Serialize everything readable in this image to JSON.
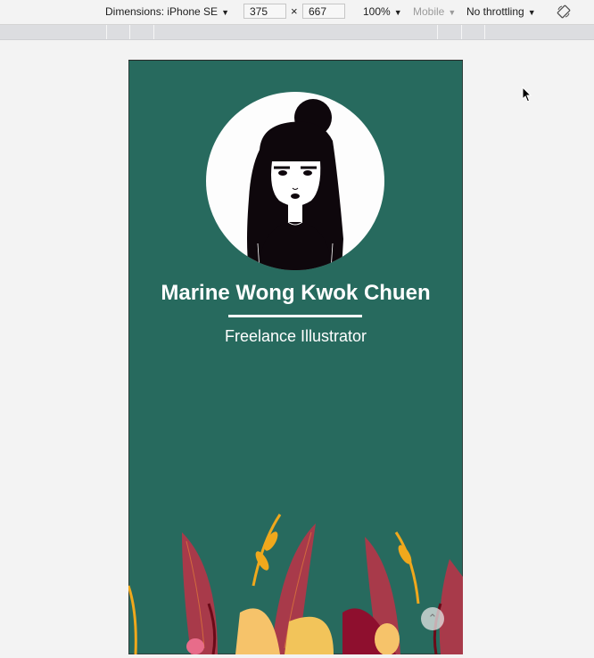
{
  "devtools": {
    "dimensions_label": "Dimensions: iPhone SE",
    "width_value": "375",
    "times_symbol": "×",
    "height_value": "667",
    "zoom": "100%",
    "device_type": "Mobile",
    "throttling": "No throttling",
    "icons": [
      "dropdown-caret",
      "rotate-icon"
    ]
  },
  "page": {
    "name": "Marine Wong Kwok Chuen",
    "role": "Freelance Illustrator",
    "colors": {
      "background": "#276a5e",
      "text": "#ffffff"
    },
    "icons": [
      "avatar-illustration",
      "scroll-to-top-icon"
    ]
  }
}
